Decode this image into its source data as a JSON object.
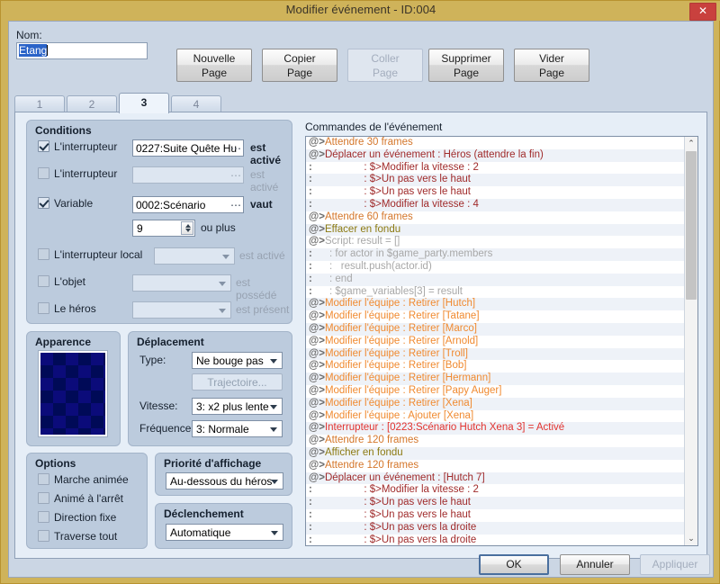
{
  "window": {
    "title": "Modifier événement - ID:004",
    "close_label": "✕",
    "title_bar_color": "#cfb35a",
    "close_color": "#c9413e"
  },
  "name_field": {
    "label": "Nom:",
    "value": "Etang",
    "selected": true
  },
  "page_buttons": [
    {
      "line1": "Nouvelle",
      "line2": "Page",
      "enabled": true
    },
    {
      "line1": "Copier",
      "line2": "Page",
      "enabled": true
    },
    {
      "line1": "Coller",
      "line2": "Page",
      "enabled": false
    },
    {
      "line1": "Supprimer",
      "line2": "Page",
      "enabled": true
    },
    {
      "line1": "Vider",
      "line2": "Page",
      "enabled": true
    }
  ],
  "tabs": [
    {
      "label": "1",
      "active": false
    },
    {
      "label": "2",
      "active": false
    },
    {
      "label": "3",
      "active": true
    },
    {
      "label": "4",
      "active": false
    }
  ],
  "conditions": {
    "title": "Conditions",
    "rows": [
      {
        "checked": true,
        "label": "L'interrupteur",
        "value": "0227:Suite Quête Hu",
        "suffix": "est activé"
      },
      {
        "checked": false,
        "label": "L'interrupteur",
        "value": "",
        "suffix": "est activé"
      },
      {
        "checked": true,
        "label": "Variable",
        "value": "0002:Scénario",
        "suffix": "vaut"
      },
      {
        "checked": false,
        "label": "L'interrupteur local",
        "value": "",
        "suffix": "est activé"
      },
      {
        "checked": false,
        "label": "L'objet",
        "value": "",
        "suffix": "est possédé"
      },
      {
        "checked": false,
        "label": "Le héros",
        "value": "",
        "suffix": "est présent"
      }
    ],
    "variable_amount": "9",
    "variable_amount_suffix": "ou plus"
  },
  "apparence": {
    "title": "Apparence"
  },
  "deplacement": {
    "title": "Déplacement",
    "type_label": "Type:",
    "type_value": "Ne bouge pas",
    "route_button": "Trajectoire...",
    "speed_label": "Vitesse:",
    "speed_value": "3: x2 plus lente",
    "freq_label": "Fréquence:",
    "freq_value": "3: Normale"
  },
  "options": {
    "title": "Options",
    "items": [
      {
        "label": "Marche animée",
        "checked": false
      },
      {
        "label": "Animé à l'arrêt",
        "checked": false
      },
      {
        "label": "Direction fixe",
        "checked": false
      },
      {
        "label": "Traverse tout",
        "checked": false
      }
    ]
  },
  "priority": {
    "title": "Priorité d'affichage",
    "value": "Au-dessous du héros"
  },
  "trigger": {
    "title": "Déclenchement",
    "value": "Automatique"
  },
  "commands": {
    "label": "Commandes de l'événement",
    "rows": [
      {
        "prefix": "@>",
        "text": "Attendre 30 frames",
        "kind": "c-wait"
      },
      {
        "prefix": "@>",
        "text": "Déplacer un événement : Héros (attendre la fin)",
        "kind": "c-move"
      },
      {
        "prefix": ":",
        "text": "                  : $>Modifier la vitesse : 2",
        "kind": "c-move"
      },
      {
        "prefix": ":",
        "text": "                  : $>Un pas vers le haut",
        "kind": "c-move"
      },
      {
        "prefix": ":",
        "text": "                  : $>Un pas vers le haut",
        "kind": "c-move"
      },
      {
        "prefix": ":",
        "text": "                  : $>Modifier la vitesse : 4",
        "kind": "c-move"
      },
      {
        "prefix": "@>",
        "text": "Attendre 60 frames",
        "kind": "c-wait"
      },
      {
        "prefix": "@>",
        "text": "Effacer en fondu",
        "kind": "c-fade"
      },
      {
        "prefix": "@>",
        "text": "Script: result = []",
        "kind": "c-script"
      },
      {
        "prefix": ":",
        "text": "      : for actor in $game_party.members",
        "kind": "c-script"
      },
      {
        "prefix": ":",
        "text": "      :   result.push(actor.id)",
        "kind": "c-script"
      },
      {
        "prefix": ":",
        "text": "      : end",
        "kind": "c-script"
      },
      {
        "prefix": ":",
        "text": "      : $game_variables[3] = result",
        "kind": "c-script"
      },
      {
        "prefix": "@>",
        "text": "Modifier l'équipe : Retirer [Hutch]",
        "kind": "c-party"
      },
      {
        "prefix": "@>",
        "text": "Modifier l'équipe : Retirer [Tatane]",
        "kind": "c-party"
      },
      {
        "prefix": "@>",
        "text": "Modifier l'équipe : Retirer [Marco]",
        "kind": "c-party"
      },
      {
        "prefix": "@>",
        "text": "Modifier l'équipe : Retirer [Arnold]",
        "kind": "c-party"
      },
      {
        "prefix": "@>",
        "text": "Modifier l'équipe : Retirer [Troll]",
        "kind": "c-party"
      },
      {
        "prefix": "@>",
        "text": "Modifier l'équipe : Retirer [Bob]",
        "kind": "c-party"
      },
      {
        "prefix": "@>",
        "text": "Modifier l'équipe : Retirer [Hermann]",
        "kind": "c-party"
      },
      {
        "prefix": "@>",
        "text": "Modifier l'équipe : Retirer [Papy Auger]",
        "kind": "c-party"
      },
      {
        "prefix": "@>",
        "text": "Modifier l'équipe : Retirer [Xena]",
        "kind": "c-party"
      },
      {
        "prefix": "@>",
        "text": "Modifier l'équipe : Ajouter [Xena]",
        "kind": "c-party"
      },
      {
        "prefix": "@>",
        "text": "Interrupteur : [0223:Scénario Hutch Xena 3] = Activé",
        "kind": "c-switch"
      },
      {
        "prefix": "@>",
        "text": "Attendre 120 frames",
        "kind": "c-wait"
      },
      {
        "prefix": "@>",
        "text": "Afficher en fondu",
        "kind": "c-fade"
      },
      {
        "prefix": "@>",
        "text": "Attendre 120 frames",
        "kind": "c-wait"
      },
      {
        "prefix": "@>",
        "text": "Déplacer un événement : [Hutch 7]",
        "kind": "c-move"
      },
      {
        "prefix": ":",
        "text": "                  : $>Modifier la vitesse : 2",
        "kind": "c-move"
      },
      {
        "prefix": ":",
        "text": "                  : $>Un pas vers le haut",
        "kind": "c-move"
      },
      {
        "prefix": ":",
        "text": "                  : $>Un pas vers le haut",
        "kind": "c-move"
      },
      {
        "prefix": ":",
        "text": "                  : $>Un pas vers la droite",
        "kind": "c-move"
      },
      {
        "prefix": ":",
        "text": "                  : $>Un pas vers la droite",
        "kind": "c-move"
      }
    ],
    "scroll_up": "⌃",
    "scroll_down": "⌄"
  },
  "footer": [
    {
      "label": "OK",
      "enabled": true,
      "focus": true
    },
    {
      "label": "Annuler",
      "enabled": true,
      "focus": false
    },
    {
      "label": "Appliquer",
      "enabled": false,
      "focus": false
    }
  ]
}
